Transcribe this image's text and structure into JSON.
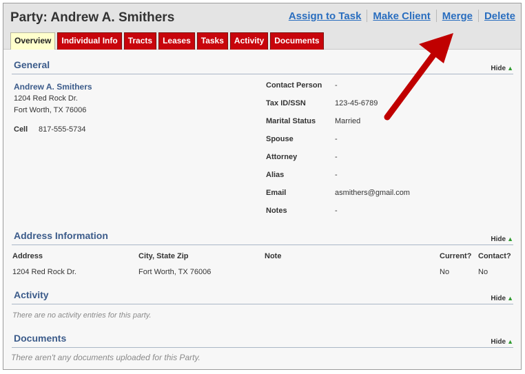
{
  "header": {
    "title": "Party: Andrew A. Smithers",
    "actions": [
      "Assign to Task",
      "Make Client",
      "Merge",
      "Delete"
    ]
  },
  "tabs": [
    "Overview",
    "Individual Info",
    "Tracts",
    "Leases",
    "Tasks",
    "Activity",
    "Documents"
  ],
  "active_tab": "Overview",
  "hide_label": "Hide",
  "general": {
    "title": "General",
    "name": "Andrew A. Smithers",
    "address_line1": "1204 Red Rock Dr.",
    "address_line2": "Fort Worth, TX 76006",
    "cell_label": "Cell",
    "cell_value": "817-555-5734",
    "fields": [
      {
        "label": "Contact Person",
        "value": "-"
      },
      {
        "label": "Tax ID/SSN",
        "value": "123-45-6789"
      },
      {
        "label": "Marital Status",
        "value": "Married"
      },
      {
        "label": "Spouse",
        "value": "-"
      },
      {
        "label": "Attorney",
        "value": "-"
      },
      {
        "label": "Alias",
        "value": "-"
      },
      {
        "label": "Email",
        "value": "asmithers@gmail.com"
      },
      {
        "label": "Notes",
        "value": "-"
      }
    ]
  },
  "address_info": {
    "title": "Address Information",
    "columns": [
      "Address",
      "City, State Zip",
      "Note",
      "Current?",
      "Contact?"
    ],
    "rows": [
      [
        "1204 Red Rock Dr.",
        "Fort Worth, TX 76006",
        "",
        "No",
        "No"
      ]
    ]
  },
  "activity": {
    "title": "Activity",
    "empty_text": "There are no activity entries for this party."
  },
  "documents": {
    "title": "Documents",
    "empty_text": "There aren't any documents uploaded for this Party."
  },
  "colors": {
    "tab_red": "#c8050c",
    "tab_active": "#ffffcc",
    "link_blue": "#2a6ebf",
    "section_blue": "#3b5b8a",
    "annotation_arrow": "#c00000"
  },
  "icons": {
    "hide": "green-up-arrow-icon"
  }
}
